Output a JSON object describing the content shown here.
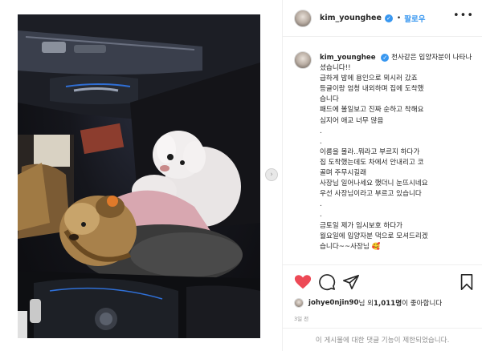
{
  "header": {
    "username": "kim_younghee",
    "verified_mark": "✓",
    "separator": "•",
    "follow_label": "팔로우",
    "more_label": "•••"
  },
  "caption": {
    "username": "kim_younghee",
    "text": "천사같은 입양자분이 나타나셨습니다!!\n급하게 밤에 용인으로 뫼시러 갔죠\n등글이랑 엄청 내외하며 집에 도착했\n습니다\n패드에 볼일보고 진짜 순하고 착해요\n심지어 애교 너무 많음\n.\n.\n이름을 몰라..뭐라고 부르지 하다가\n집 도착했는데도 차에서 안내리고 코\n골며 주무시길래\n사장님 일어나세요 했더니 눈뜨시네요\n우선 사장님이라고 부르고 있습니다\n.\n.\n금토일 제가 임시보호 하다가\n월요일에 입양자분 댁으로 모셔드리겠\n습니다~~사장님 🥰"
  },
  "carousel_next_glyph": "›",
  "actions": {
    "like_icon": "heart-icon",
    "comment_icon": "comment-icon",
    "share_icon": "share-icon",
    "save_icon": "bookmark-icon",
    "like_color": "#ed4956"
  },
  "likes": {
    "liker": "johye0njin90",
    "mid": "님 외 ",
    "count": "1,011명",
    "tail": "이 좋아합니다"
  },
  "timestamp": "3일 전",
  "comments_disabled": "이 게시물에 대한 댓글 기능이 제한되었습니다."
}
